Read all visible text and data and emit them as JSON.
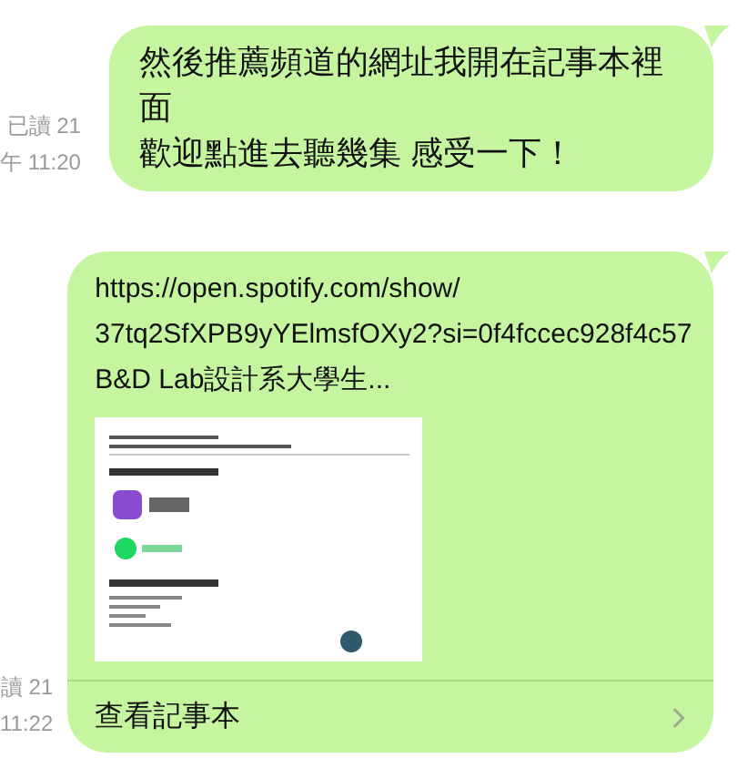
{
  "messages": [
    {
      "kind": "text",
      "read_status": "已讀 21",
      "time": "午 11:20",
      "lines": [
        "然後推薦頻道的網址我開在記事本裡面",
        "歡迎點進去聽幾集 感受一下！"
      ]
    },
    {
      "kind": "note",
      "read_status": "讀 21",
      "time": "11:22",
      "link_lines": [
        "https://open.spotify.com/show/",
        "37tq2SfXPB9yYElmsfOXy2?si=0f4fccec928f4c57"
      ],
      "title": "B&D Lab設計系大學生...",
      "action": "查看記事本"
    }
  ]
}
